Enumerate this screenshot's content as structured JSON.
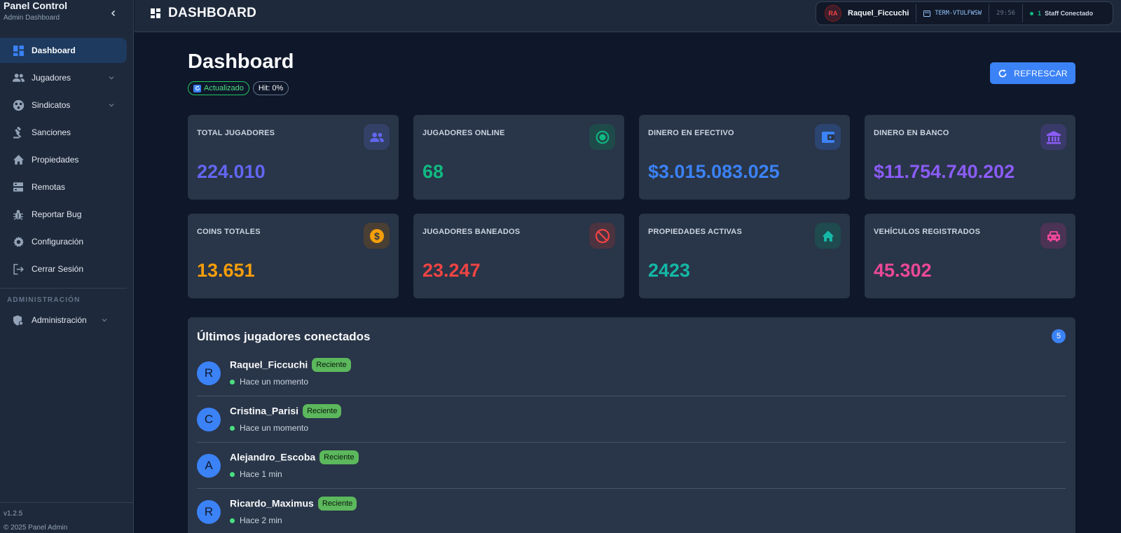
{
  "sidebar": {
    "title": "Panel Control",
    "subtitle": "Admin Dashboard",
    "items": [
      {
        "label": "Dashboard",
        "icon": "dashboard-icon"
      },
      {
        "label": "Jugadores",
        "icon": "people-icon"
      },
      {
        "label": "Sindicatos",
        "icon": "syndicate-icon"
      },
      {
        "label": "Sanciones",
        "icon": "gavel-icon"
      },
      {
        "label": "Propiedades",
        "icon": "home-icon"
      },
      {
        "label": "Remotas",
        "icon": "server-icon"
      },
      {
        "label": "Reportar Bug",
        "icon": "bug-icon"
      },
      {
        "label": "Configuración",
        "icon": "gear-icon"
      },
      {
        "label": "Cerrar Sesión",
        "icon": "logout-icon"
      }
    ],
    "section_label": "ADMINISTRACIÓN",
    "admin_item": "Administración",
    "version": "v1.2.5",
    "copyright": "© 2025 Panel Admin"
  },
  "topbar": {
    "title": "DASHBOARD",
    "avatar_initials": "RA",
    "username": "Raquel_Ficcuchi",
    "terminal": "TERM-VTULFWSW",
    "time": "29:56",
    "staff_count": "1",
    "staff_label": "Staff Conectado"
  },
  "main": {
    "title": "Dashboard",
    "badge_status": "Actualizado",
    "badge_hit": "Hit: 0%",
    "refresh_label": "REFRESCAR"
  },
  "stats": [
    {
      "label": "TOTAL JUGADORES",
      "value": "224.010",
      "color": "#6366f1"
    },
    {
      "label": "JUGADORES ONLINE",
      "value": "68",
      "color": "#10b981"
    },
    {
      "label": "DINERO EN EFECTIVO",
      "value": "$3.015.083.025",
      "color": "#3b82f6"
    },
    {
      "label": "DINERO EN BANCO",
      "value": "$11.754.740.202",
      "color": "#8b5cf6"
    },
    {
      "label": "COINS TOTALES",
      "value": "13.651",
      "color": "#f59e0b"
    },
    {
      "label": "JUGADORES BANEADOS",
      "value": "23.247",
      "color": "#ef4444"
    },
    {
      "label": "PROPIEDADES ACTIVAS",
      "value": "2423",
      "color": "#14b8a6"
    },
    {
      "label": "VEHÍCULOS REGISTRADOS",
      "value": "45.302",
      "color": "#ec4899"
    }
  ],
  "recent": {
    "title": "Últimos jugadores conectados",
    "count": "5",
    "players": [
      {
        "initial": "R",
        "name": "Raquel_Ficcuchi",
        "badge": "Reciente",
        "time": "Hace un momento"
      },
      {
        "initial": "C",
        "name": "Cristina_Parisi",
        "badge": "Reciente",
        "time": "Hace un momento"
      },
      {
        "initial": "A",
        "name": "Alejandro_Escoba",
        "badge": "Reciente",
        "time": "Hace 1 min"
      },
      {
        "initial": "R",
        "name": "Ricardo_Maximus",
        "badge": "Reciente",
        "time": "Hace 2 min"
      }
    ]
  }
}
